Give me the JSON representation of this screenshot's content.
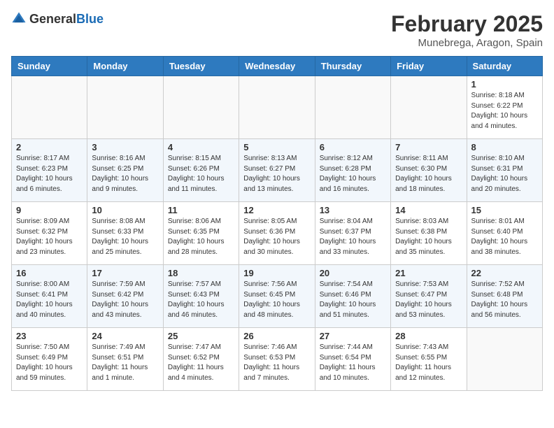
{
  "header": {
    "logo_general": "General",
    "logo_blue": "Blue",
    "month_title": "February 2025",
    "location": "Munebrega, Aragon, Spain"
  },
  "weekdays": [
    "Sunday",
    "Monday",
    "Tuesday",
    "Wednesday",
    "Thursday",
    "Friday",
    "Saturday"
  ],
  "weeks": [
    [
      null,
      null,
      null,
      null,
      null,
      null,
      {
        "day": "1",
        "sunrise": "8:18 AM",
        "sunset": "6:22 PM",
        "daylight": "10 hours and 4 minutes."
      }
    ],
    [
      {
        "day": "2",
        "sunrise": "8:17 AM",
        "sunset": "6:23 PM",
        "daylight": "10 hours and 6 minutes."
      },
      {
        "day": "3",
        "sunrise": "8:16 AM",
        "sunset": "6:25 PM",
        "daylight": "10 hours and 9 minutes."
      },
      {
        "day": "4",
        "sunrise": "8:15 AM",
        "sunset": "6:26 PM",
        "daylight": "10 hours and 11 minutes."
      },
      {
        "day": "5",
        "sunrise": "8:13 AM",
        "sunset": "6:27 PM",
        "daylight": "10 hours and 13 minutes."
      },
      {
        "day": "6",
        "sunrise": "8:12 AM",
        "sunset": "6:28 PM",
        "daylight": "10 hours and 16 minutes."
      },
      {
        "day": "7",
        "sunrise": "8:11 AM",
        "sunset": "6:30 PM",
        "daylight": "10 hours and 18 minutes."
      },
      {
        "day": "8",
        "sunrise": "8:10 AM",
        "sunset": "6:31 PM",
        "daylight": "10 hours and 20 minutes."
      }
    ],
    [
      {
        "day": "9",
        "sunrise": "8:09 AM",
        "sunset": "6:32 PM",
        "daylight": "10 hours and 23 minutes."
      },
      {
        "day": "10",
        "sunrise": "8:08 AM",
        "sunset": "6:33 PM",
        "daylight": "10 hours and 25 minutes."
      },
      {
        "day": "11",
        "sunrise": "8:06 AM",
        "sunset": "6:35 PM",
        "daylight": "10 hours and 28 minutes."
      },
      {
        "day": "12",
        "sunrise": "8:05 AM",
        "sunset": "6:36 PM",
        "daylight": "10 hours and 30 minutes."
      },
      {
        "day": "13",
        "sunrise": "8:04 AM",
        "sunset": "6:37 PM",
        "daylight": "10 hours and 33 minutes."
      },
      {
        "day": "14",
        "sunrise": "8:03 AM",
        "sunset": "6:38 PM",
        "daylight": "10 hours and 35 minutes."
      },
      {
        "day": "15",
        "sunrise": "8:01 AM",
        "sunset": "6:40 PM",
        "daylight": "10 hours and 38 minutes."
      }
    ],
    [
      {
        "day": "16",
        "sunrise": "8:00 AM",
        "sunset": "6:41 PM",
        "daylight": "10 hours and 40 minutes."
      },
      {
        "day": "17",
        "sunrise": "7:59 AM",
        "sunset": "6:42 PM",
        "daylight": "10 hours and 43 minutes."
      },
      {
        "day": "18",
        "sunrise": "7:57 AM",
        "sunset": "6:43 PM",
        "daylight": "10 hours and 46 minutes."
      },
      {
        "day": "19",
        "sunrise": "7:56 AM",
        "sunset": "6:45 PM",
        "daylight": "10 hours and 48 minutes."
      },
      {
        "day": "20",
        "sunrise": "7:54 AM",
        "sunset": "6:46 PM",
        "daylight": "10 hours and 51 minutes."
      },
      {
        "day": "21",
        "sunrise": "7:53 AM",
        "sunset": "6:47 PM",
        "daylight": "10 hours and 53 minutes."
      },
      {
        "day": "22",
        "sunrise": "7:52 AM",
        "sunset": "6:48 PM",
        "daylight": "10 hours and 56 minutes."
      }
    ],
    [
      {
        "day": "23",
        "sunrise": "7:50 AM",
        "sunset": "6:49 PM",
        "daylight": "10 hours and 59 minutes."
      },
      {
        "day": "24",
        "sunrise": "7:49 AM",
        "sunset": "6:51 PM",
        "daylight": "11 hours and 1 minute."
      },
      {
        "day": "25",
        "sunrise": "7:47 AM",
        "sunset": "6:52 PM",
        "daylight": "11 hours and 4 minutes."
      },
      {
        "day": "26",
        "sunrise": "7:46 AM",
        "sunset": "6:53 PM",
        "daylight": "11 hours and 7 minutes."
      },
      {
        "day": "27",
        "sunrise": "7:44 AM",
        "sunset": "6:54 PM",
        "daylight": "11 hours and 10 minutes."
      },
      {
        "day": "28",
        "sunrise": "7:43 AM",
        "sunset": "6:55 PM",
        "daylight": "11 hours and 12 minutes."
      },
      null
    ]
  ]
}
